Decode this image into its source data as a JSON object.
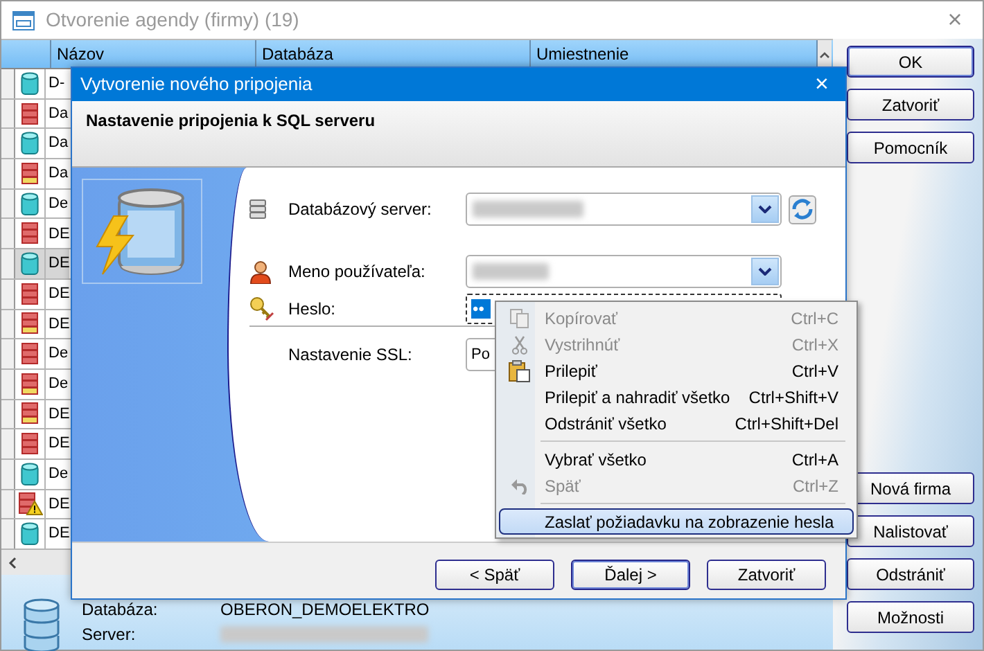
{
  "window": {
    "title": "Otvorenie agendy (firmy) (19)",
    "close": "×"
  },
  "table": {
    "columns": [
      "Názov",
      "Databáza",
      "Umiestnenie"
    ],
    "rows": [
      {
        "name": "D-",
        "kind": "cylinder",
        "selected": false
      },
      {
        "name": "Da",
        "kind": "stack",
        "selected": false
      },
      {
        "name": "Da",
        "kind": "cylinder",
        "selected": false
      },
      {
        "name": "Da",
        "kind": "stack-marked",
        "selected": false
      },
      {
        "name": "De",
        "kind": "cylinder",
        "selected": false
      },
      {
        "name": "DE",
        "kind": "stack",
        "selected": false
      },
      {
        "name": "DE",
        "kind": "cylinder",
        "selected": true
      },
      {
        "name": "DE",
        "kind": "stack",
        "selected": false
      },
      {
        "name": "DE",
        "kind": "stack-marked",
        "selected": false
      },
      {
        "name": "De",
        "kind": "stack",
        "selected": false
      },
      {
        "name": "De",
        "kind": "stack-marked",
        "selected": false
      },
      {
        "name": "DE",
        "kind": "stack-marked",
        "selected": false
      },
      {
        "name": "DE",
        "kind": "stack",
        "selected": false
      },
      {
        "name": "De",
        "kind": "cylinder",
        "selected": false
      },
      {
        "name": "DE",
        "kind": "stack-warning",
        "selected": false
      },
      {
        "name": "DE",
        "kind": "cylinder",
        "selected": false
      }
    ]
  },
  "info_panel": {
    "rows": [
      {
        "label": "Databáza:",
        "value": "OBERON_DEMOELEKTRO",
        "redacted": false
      },
      {
        "label": "Server:",
        "redacted": true
      }
    ]
  },
  "buttons_top": [
    {
      "label": "OK",
      "focused": true
    },
    {
      "label": "Zatvoriť",
      "focused": false
    },
    {
      "label": "Pomocník",
      "focused": false
    }
  ],
  "buttons_bottom": [
    {
      "label": "Nová firma",
      "focused": false
    },
    {
      "label": "Nalistovať",
      "focused": false
    },
    {
      "label": "Odstrániť",
      "focused": false
    },
    {
      "label": "Možnosti",
      "focused": false
    }
  ],
  "dialog": {
    "title": "Vytvorenie nového pripojenia",
    "close": "×",
    "header": "Nastavenie pripojenia k SQL serveru",
    "fields": [
      {
        "kind": "server",
        "label": "Databázový server:",
        "redacted": true
      },
      {
        "kind": "user",
        "label": "Meno používateľa:",
        "redacted": true
      },
      {
        "kind": "password",
        "label": "Heslo:",
        "value": "••"
      },
      {
        "kind": "ssl",
        "label": "Nastavenie SSL:",
        "value": "Po"
      }
    ],
    "buttons": [
      {
        "label": "< Späť",
        "focused": false
      },
      {
        "label": "Ďalej >",
        "focused": true
      },
      {
        "label": "Zatvoriť",
        "focused": false
      }
    ]
  },
  "context_menu": {
    "items": [
      {
        "kind": "copy",
        "label": "Kopírovať",
        "shortcut": "Ctrl+C",
        "disabled": true,
        "selected": false
      },
      {
        "kind": "cut",
        "label": "Vystrihnúť",
        "shortcut": "Ctrl+X",
        "disabled": true,
        "selected": false
      },
      {
        "kind": "paste",
        "label": "Prilepiť",
        "shortcut": "Ctrl+V",
        "disabled": false,
        "selected": false
      },
      {
        "kind": "plain",
        "label": "Prilepiť a nahradiť všetko",
        "shortcut": "Ctrl+Shift+V",
        "disabled": false,
        "selected": false
      },
      {
        "kind": "plain",
        "label": "Odstrániť všetko",
        "shortcut": "Ctrl+Shift+Del",
        "disabled": false,
        "selected": false
      },
      {
        "kind": "separator"
      },
      {
        "kind": "plain",
        "label": "Vybrať všetko",
        "shortcut": "Ctrl+A",
        "disabled": false,
        "selected": false
      },
      {
        "kind": "undo",
        "label": "Späť",
        "shortcut": "Ctrl+Z",
        "disabled": true,
        "selected": false
      },
      {
        "kind": "separator"
      },
      {
        "kind": "plain",
        "label": "Zaslať požiadavku na zobrazenie hesla",
        "disabled": false,
        "selected": true
      }
    ]
  }
}
